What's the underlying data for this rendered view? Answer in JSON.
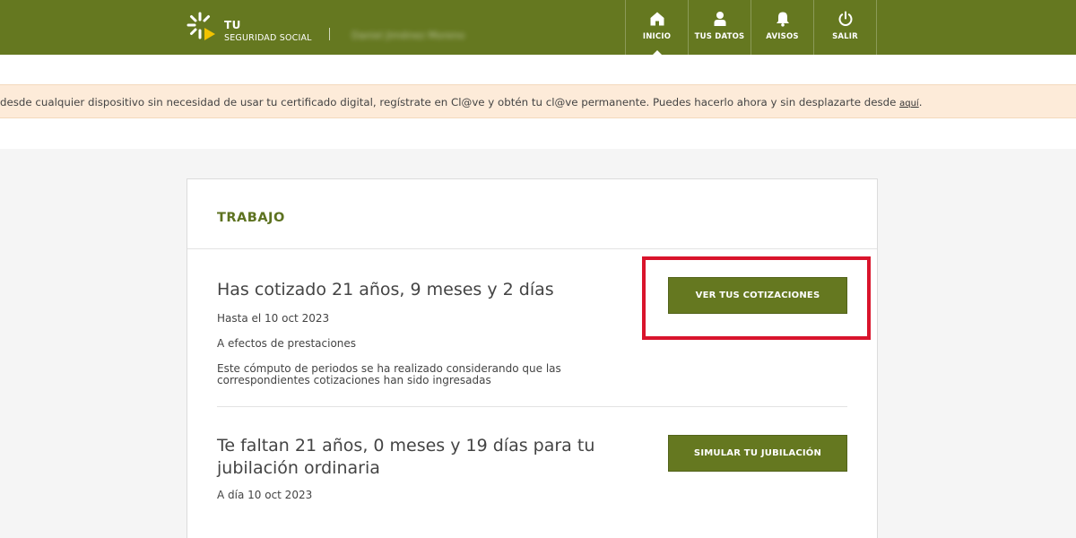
{
  "header": {
    "brand_line1": "TU",
    "brand_line2": "SEGURIDAD SOCIAL",
    "user_name": "Daniel Jiménez Moreno",
    "nav": [
      {
        "label": "INICIO",
        "icon": "home-icon",
        "active": true
      },
      {
        "label": "TUS DATOS",
        "icon": "user-icon"
      },
      {
        "label": "AVISOS",
        "icon": "bell-icon"
      },
      {
        "label": "SALIR",
        "icon": "power-icon"
      }
    ]
  },
  "banner": {
    "text": "desde cualquier dispositivo sin necesidad de usar tu certificado digital, regístrate en Cl@ve y obtén tu cl@ve permanente. Puedes hacerlo ahora y sin desplazarte desde ",
    "link": "aquí",
    "suffix": "."
  },
  "card": {
    "title": "TRABAJO",
    "section1": {
      "title": "Has cotizado 21 años, 9 meses y 2 días",
      "date": "Hasta el 10 oct 2023",
      "effects": "A efectos de prestaciones",
      "note": "Este cómputo de periodos se ha realizado considerando que las correspondientes cotizaciones han sido ingresadas",
      "button": "VER TUS COTIZACIONES"
    },
    "section2": {
      "title": "Te faltan 21 años, 0 meses y 19 días para tu jubilación ordinaria",
      "date": "A día 10 oct 2023",
      "button": "SIMULAR TU JUBILACIÓN"
    }
  },
  "colors": {
    "primary": "#657820",
    "highlight": "#d9142c",
    "banner_bg": "#fdebd9"
  }
}
